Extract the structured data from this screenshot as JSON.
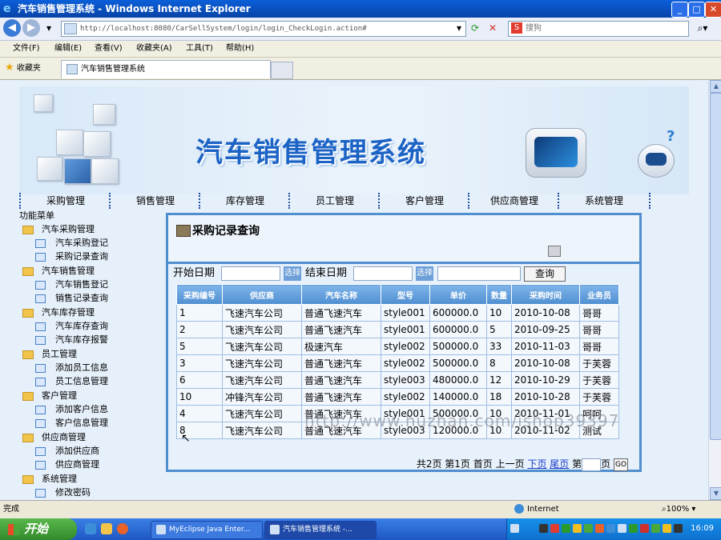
{
  "window": {
    "title": "汽车销售管理系统 - Windows Internet Explorer",
    "url": "http://localhost:8080/CarSellSystem/login/login_CheckLogin.action#",
    "search_placeholder": "搜狗"
  },
  "menubar": [
    "文件(F)",
    "编辑(E)",
    "查看(V)",
    "收藏夹(A)",
    "工具(T)",
    "帮助(H)"
  ],
  "favorites": {
    "label": "收藏夹",
    "tab_title": "汽车销售管理系统"
  },
  "banner": {
    "title": "汽车销售管理系统"
  },
  "nav": [
    "采购管理",
    "销售管理",
    "库存管理",
    "员工管理",
    "客户管理",
    "供应商管理",
    "系统管理"
  ],
  "sidebar": {
    "title": "功能菜单",
    "groups": [
      {
        "label": "汽车采购管理",
        "items": [
          "汽车采购登记",
          "采购记录查询"
        ]
      },
      {
        "label": "汽车销售管理",
        "items": [
          "汽车销售登记",
          "销售记录查询"
        ]
      },
      {
        "label": "汽车库存管理",
        "items": [
          "汽车库存查询",
          "汽车库存报警"
        ]
      },
      {
        "label": "员工管理",
        "items": [
          "添加员工信息",
          "员工信息管理"
        ]
      },
      {
        "label": "客户管理",
        "items": [
          "添加客户信息",
          "客户信息管理"
        ]
      },
      {
        "label": "供应商管理",
        "items": [
          "添加供应商",
          "供应商管理"
        ]
      },
      {
        "label": "系统管理",
        "items": [
          "修改密码"
        ]
      }
    ]
  },
  "panel": {
    "title": "采购记录查询",
    "query": {
      "start_label": "开始日期",
      "end_label": "结束日期",
      "pick_label": "选择",
      "search_label": "查询"
    },
    "columns": [
      "采购编号",
      "供应商",
      "汽车名称",
      "型号",
      "单价",
      "数量",
      "采购时间",
      "业务员"
    ],
    "rows": [
      [
        "1",
        "飞速汽车公司",
        "普通飞速汽车",
        "style001",
        "600000.0",
        "10",
        "2010-10-08",
        "哥哥"
      ],
      [
        "2",
        "飞速汽车公司",
        "普通飞速汽车",
        "style001",
        "600000.0",
        "5",
        "2010-09-25",
        "哥哥"
      ],
      [
        "5",
        "飞速汽车公司",
        "极速汽车",
        "style002",
        "500000.0",
        "33",
        "2010-11-03",
        "哥哥"
      ],
      [
        "3",
        "飞速汽车公司",
        "普通飞速汽车",
        "style002",
        "500000.0",
        "8",
        "2010-10-08",
        "于芙蓉"
      ],
      [
        "6",
        "飞速汽车公司",
        "普通飞速汽车",
        "style003",
        "480000.0",
        "12",
        "2010-10-29",
        "于芙蓉"
      ],
      [
        "10",
        "冲锋汽车公司",
        "普通飞速汽车",
        "style002",
        "140000.0",
        "18",
        "2010-10-28",
        "于芙蓉"
      ],
      [
        "4",
        "飞速汽车公司",
        "普通飞速汽车",
        "style001",
        "500000.0",
        "10",
        "2010-11-01",
        "呵呵"
      ],
      [
        "8",
        "飞速汽车公司",
        "普通飞速汽车",
        "style003",
        "120000.0",
        "10",
        "2010-11-02",
        "测试"
      ]
    ],
    "pager": {
      "total": "共2页",
      "current": "第1页",
      "first": "首页",
      "prev": "上一页",
      "next": "下页",
      "last": "尾页",
      "goto_prefix": "第",
      "goto_suffix": "页",
      "go": "GO"
    }
  },
  "watermark": "http://www.huzhan.com/ishop39397",
  "status": {
    "text": "完成",
    "zone": "Internet",
    "zoom": "100%"
  },
  "taskbar": {
    "start": "开始",
    "buttons": [
      "MyEclipse Java Enter...",
      "汽车销售管理系统 -..."
    ],
    "clock": "16:09"
  }
}
